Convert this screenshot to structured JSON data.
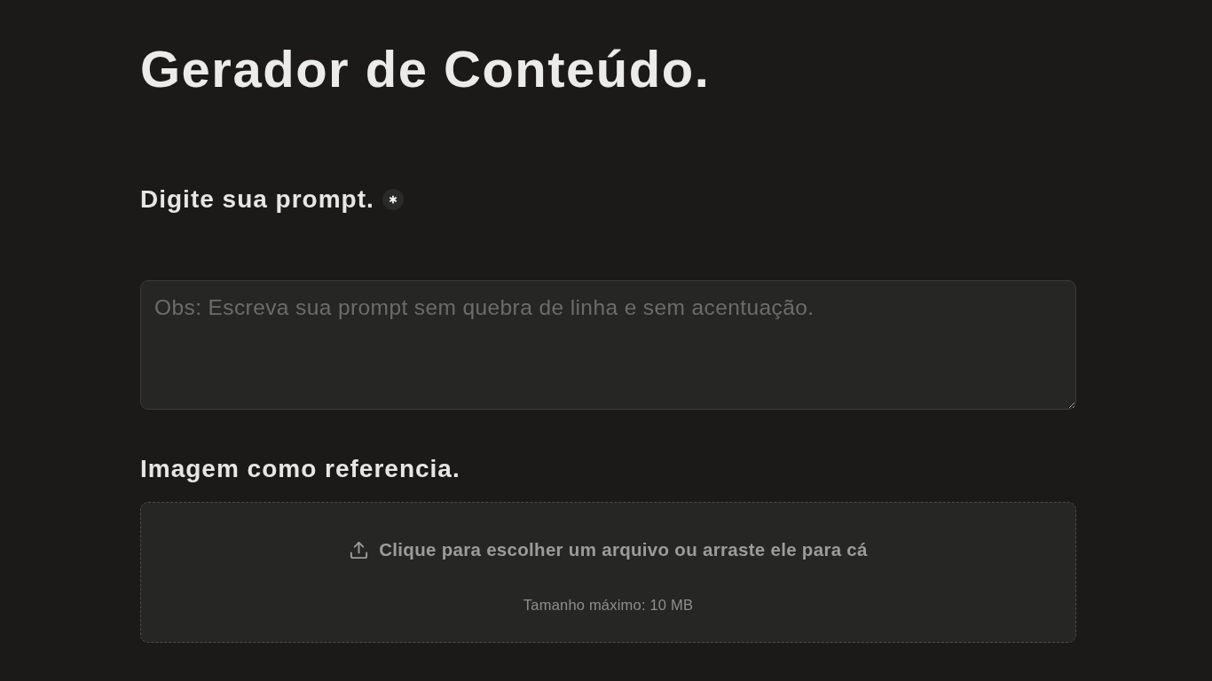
{
  "title": "Gerador de Conteúdo.",
  "prompt_field": {
    "label": "Digite sua prompt.",
    "required": true,
    "placeholder": "Obs: Escreva sua prompt sem quebra de linha e sem acentuação."
  },
  "image_field": {
    "label": "Imagem como referencia.",
    "upload_text": "Clique para escolher um arquivo ou arraste ele para cá",
    "size_limit": "Tamanho máximo: 10 MB"
  }
}
